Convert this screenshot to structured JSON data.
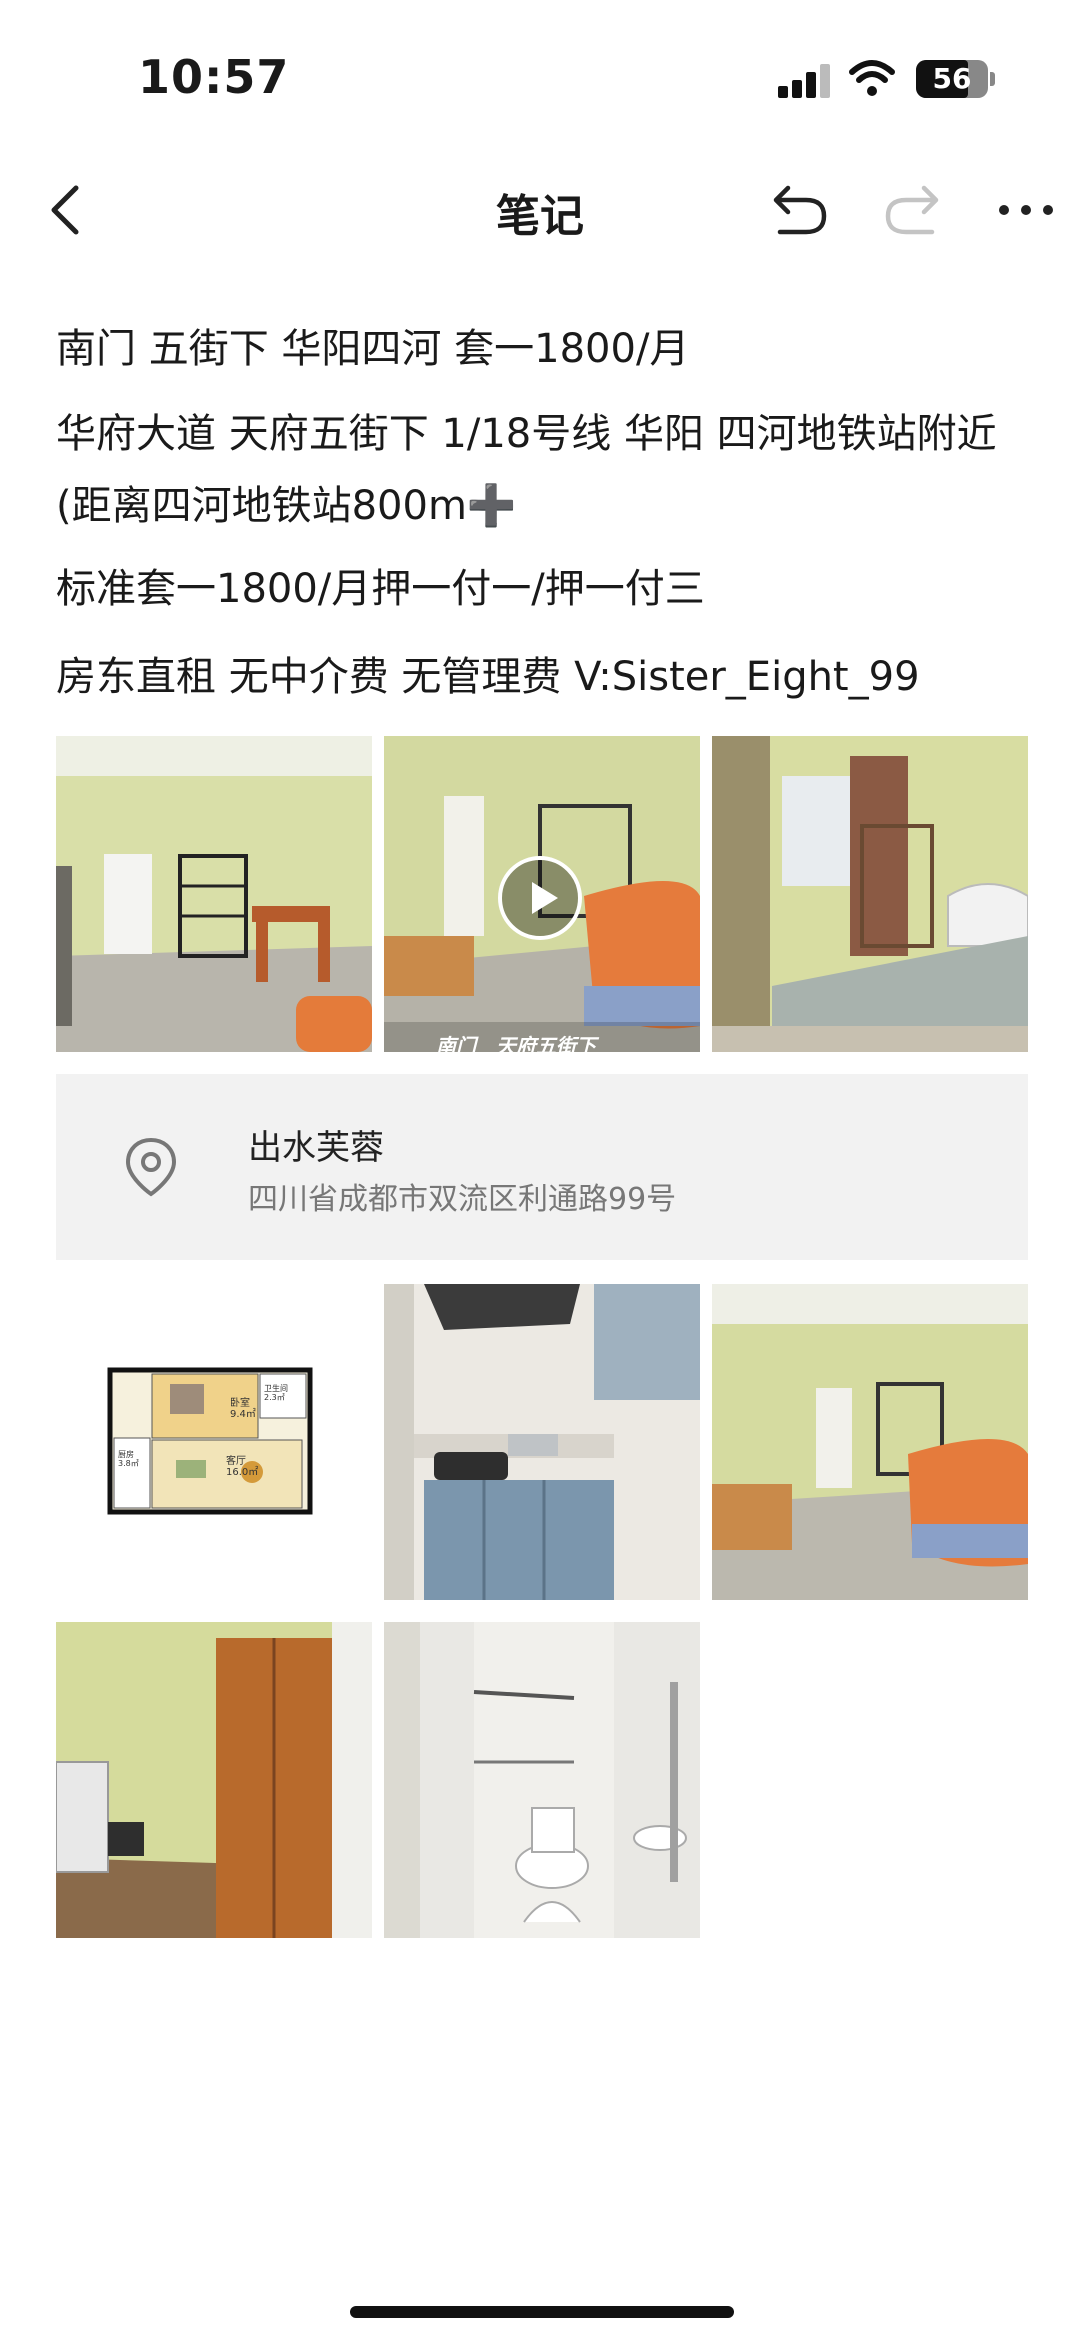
{
  "status_bar": {
    "time": "10:57",
    "battery": "56"
  },
  "nav": {
    "title": "笔记",
    "back_icon": "chevron-left-icon",
    "undo_icon": "undo-icon",
    "redo_icon": "redo-icon",
    "more_icon": "more-horizontal-icon"
  },
  "note": {
    "line1": "南门 五街下 华阳四河 套一1800/月",
    "line2": " 华府大道 天府五街下 1/18号线 华阳 四河地铁站附近 (距离四河地铁站800m➕",
    "line3": "标准套一1800/月押一付一/押一付三",
    "line4": "房东直租 无中介费 无管理费 V:Sister_Eight_99"
  },
  "video_caption": "南门　天府五街下",
  "location": {
    "name": "出水芙蓉",
    "address": "四川省成都市双流区利通路99号"
  },
  "floorplan": {
    "bedroom": "卧室",
    "bedroom_area": "9.4㎡",
    "bathroom": "卫生间",
    "bathroom_area": "2.3㎡",
    "kitchen": "厨房",
    "kitchen_area": "3.8㎡",
    "living": "客厅",
    "living_area": "16.0㎡"
  },
  "colors": {
    "wall_green": "#d6dc9a",
    "floor_grey": "#b9b6ad",
    "card_bg": "#f2f2f2"
  }
}
